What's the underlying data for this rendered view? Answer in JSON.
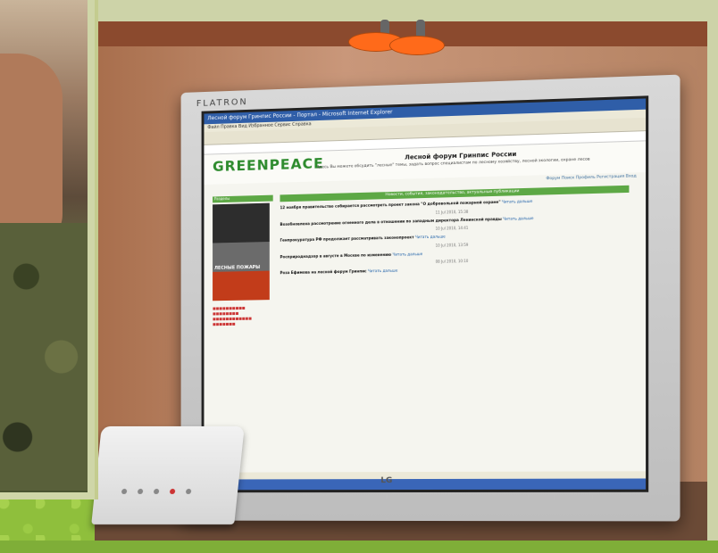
{
  "monitor": {
    "brand": "FLATRON",
    "maker": "LG"
  },
  "browser": {
    "title": "Лесной форум Гринпис России - Портал - Microsoft Internet Explorer",
    "menu": "Файл  Правка  Вид  Избранное  Сервис  Справка"
  },
  "page": {
    "logo": "GREENPEACE",
    "title": "Лесной форум Гринпис России",
    "subtitle": "Здесь Вы можете обсудить \"лесные\" темы, задать вопрос специалистам по лесному хозяйству, лесной экологии, охране лесов",
    "nav": "Форум  Поиск  Профиль  Регистрация  Вход",
    "content_bar": "Новости, события, законодательство, актуальные публикации",
    "sidebar_head": "Разделы",
    "poster_text": "ЛЕСНЫЕ ПОЖАРЫ",
    "articles": [
      {
        "date": "",
        "headline": "12 ноября правительство собирается рассмотреть проект закона \"О добровольной пожарной охране\"",
        "more": "Читать дальше"
      },
      {
        "date": "11 Jul 2010, 15:38",
        "headline": "Возобновлена рассмотрение огненного дела в отношении по западным директора Ленинской правды",
        "more": "Читать дальше"
      },
      {
        "date": "10 Jul 2010, 14:41",
        "headline": "Генпрокуратура РФ продолжает рассматривать законопроект",
        "more": "Читать дальше"
      },
      {
        "date": "10 Jul 2010, 13:59",
        "headline": "Росприроднадзор в августе в Москве по изменению",
        "more": "Читать дальше"
      },
      {
        "date": "08 Jul 2010, 10:10",
        "headline": "Роза Ефимова на лесной форум Гринпис",
        "more": "Читать дальше"
      }
    ]
  }
}
